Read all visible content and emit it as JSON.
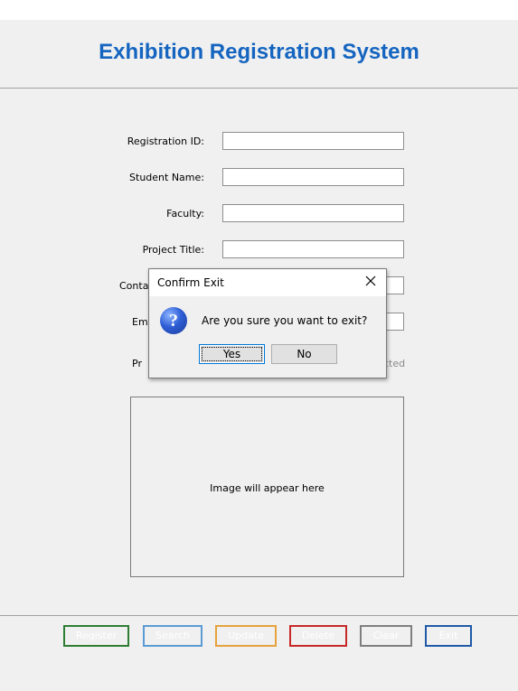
{
  "app": {
    "title": "Exhibition Registration System"
  },
  "form": {
    "fields": [
      {
        "label": "Registration ID:",
        "value": ""
      },
      {
        "label": "Student Name:",
        "value": ""
      },
      {
        "label": "Faculty:",
        "value": ""
      },
      {
        "label": "Project Title:",
        "value": ""
      },
      {
        "label": "Contact Number:",
        "value": ""
      },
      {
        "label": "Em",
        "value": ""
      },
      {
        "label": "Pr",
        "value": ""
      }
    ],
    "photo_status_partial": "cted",
    "image_placeholder": "Image will appear here"
  },
  "buttons": {
    "register": {
      "label": "Register",
      "color": "#2e7d32"
    },
    "search": {
      "label": "Search",
      "color": "#5b9bd5"
    },
    "update": {
      "label": "Update",
      "color": "#e6a23c"
    },
    "delete": {
      "label": "Delete",
      "color": "#c62828"
    },
    "clear": {
      "label": "Clear",
      "color": "#7f7f7f"
    },
    "exit": {
      "label": "Exit",
      "color": "#1e5aa8"
    }
  },
  "dialog": {
    "title": "Confirm Exit",
    "message": "Are you sure you want to exit?",
    "yes_label": "Yes",
    "no_label": "No",
    "icon": "question-icon",
    "close_icon": "close-icon"
  },
  "colors": {
    "title": "#1565c0",
    "window_bg": "#f0f0f0"
  }
}
